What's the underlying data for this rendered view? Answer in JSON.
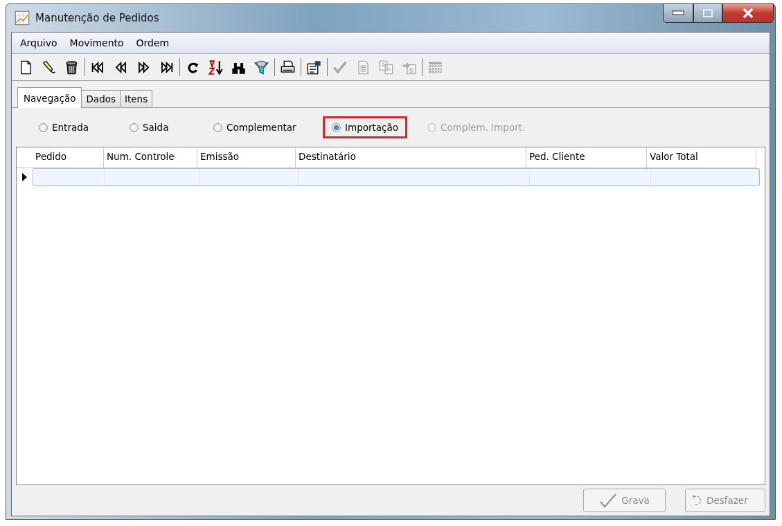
{
  "window": {
    "title": "Manutenção de Pedidos"
  },
  "menu": [
    "Arquivo",
    "Movimento",
    "Ordem"
  ],
  "toolbar": [
    [
      {
        "disabled": false
      },
      {
        "disabled": false
      },
      {
        "disabled": false
      }
    ],
    [
      {
        "disabled": false
      },
      {
        "disabled": false
      },
      {
        "disabled": false
      },
      {
        "disabled": false
      }
    ],
    [
      {
        "disabled": false
      },
      {
        "disabled": false
      },
      {
        "disabled": false
      },
      {
        "disabled": false
      }
    ],
    [
      {
        "disabled": false
      }
    ],
    [
      {
        "disabled": false
      }
    ],
    [
      {
        "disabled": true
      },
      {
        "disabled": true
      },
      {
        "disabled": true
      },
      {
        "disabled": true
      }
    ],
    [
      {
        "disabled": true
      }
    ]
  ],
  "tabs": [
    {
      "label": "Navegação",
      "selected": true
    },
    {
      "label": "Dados",
      "selected": false
    },
    {
      "label": "Itens",
      "selected": false
    }
  ],
  "order_types": [
    {
      "label": "Entrada",
      "selected": false,
      "disabled": false,
      "highlighted": false
    },
    {
      "label": "Saida",
      "selected": false,
      "disabled": false,
      "highlighted": false
    },
    {
      "label": "Complementar",
      "selected": false,
      "disabled": false,
      "highlighted": false
    },
    {
      "label": "Importação",
      "selected": true,
      "disabled": false,
      "highlighted": true
    },
    {
      "label": "Complem. Import.",
      "selected": false,
      "disabled": true,
      "highlighted": false
    }
  ],
  "table": {
    "columns": [
      "Pedido",
      "Num. Controle",
      "Emissão",
      "Destinatário",
      "Ped. Cliente",
      "Valor Total"
    ],
    "rows": [
      {
        "selected": true
      }
    ]
  },
  "buttons": [
    {
      "label": "Grava",
      "disabled": true
    },
    {
      "label": "Desfazer",
      "disabled": true
    }
  ]
}
